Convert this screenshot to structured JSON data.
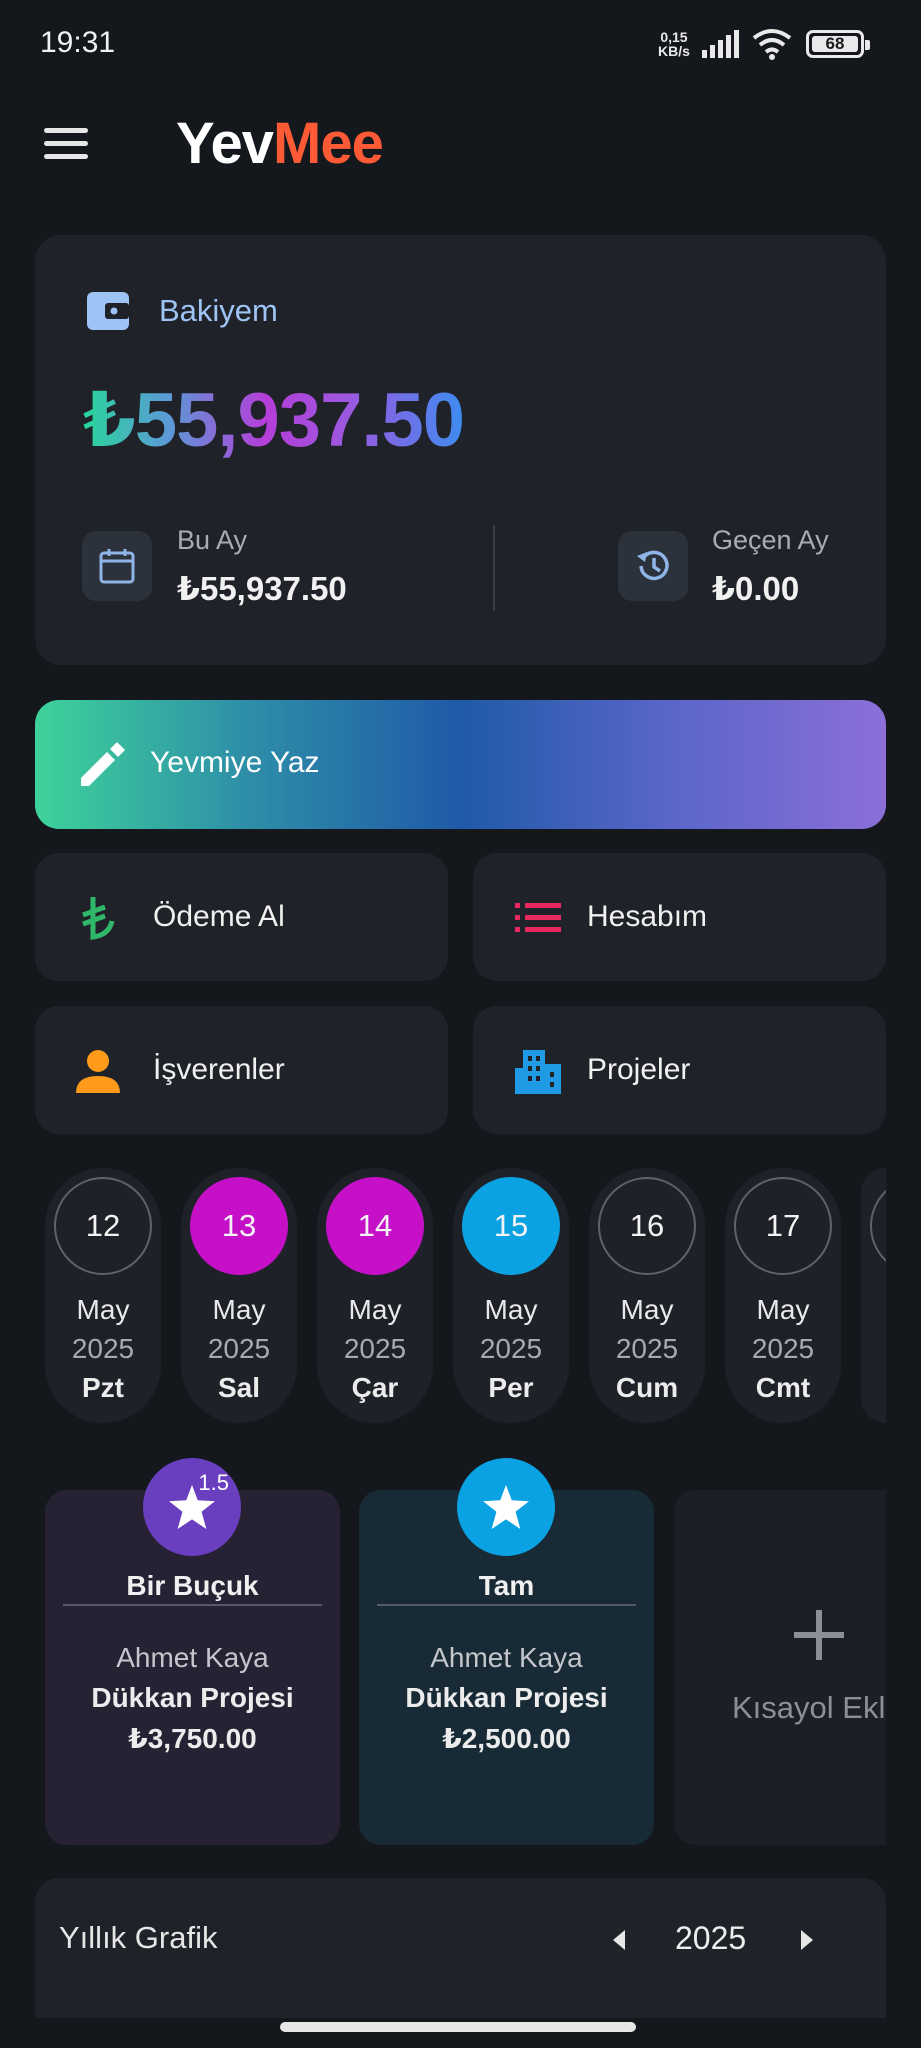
{
  "status": {
    "time": "19:31",
    "speed_value": "0,15",
    "speed_unit": "KB/s",
    "battery": "68"
  },
  "header": {
    "logo_part1": "Yev",
    "logo_part2": "Mee"
  },
  "balance": {
    "label": "Bakiyem",
    "amount": "₺55,937.50",
    "this_month_label": "Bu Ay",
    "this_month_value": "₺55,937.50",
    "last_month_label": "Geçen Ay",
    "last_month_value": "₺0.00"
  },
  "actions": {
    "yevmiye_label": "Yevmiye Yaz",
    "odeme_label": "Ödeme Al",
    "hesabim_label": "Hesabım",
    "isverenler_label": "İşverenler",
    "projeler_label": "Projeler"
  },
  "days": [
    {
      "day": "12",
      "month": "May",
      "year": "2025",
      "weekday": "Pzt",
      "state": "normal"
    },
    {
      "day": "13",
      "month": "May",
      "year": "2025",
      "weekday": "Sal",
      "state": "marked"
    },
    {
      "day": "14",
      "month": "May",
      "year": "2025",
      "weekday": "Çar",
      "state": "marked"
    },
    {
      "day": "15",
      "month": "May",
      "year": "2025",
      "weekday": "Per",
      "state": "today"
    },
    {
      "day": "16",
      "month": "May",
      "year": "2025",
      "weekday": "Cum",
      "state": "normal"
    },
    {
      "day": "17",
      "month": "May",
      "year": "2025",
      "weekday": "Cmt",
      "state": "normal"
    }
  ],
  "shortcuts": [
    {
      "badge_number": "1.5",
      "title": "Bir Buçuk",
      "person": "Ahmet Kaya",
      "project": "Dükkan Projesi",
      "amount": "₺3,750.00",
      "color": "#6a3fbf",
      "bg": "#262234"
    },
    {
      "badge_number": "",
      "title": "Tam",
      "person": "Ahmet Kaya",
      "project": "Dükkan Projesi",
      "amount": "₺2,500.00",
      "color": "#0aa2e3",
      "bg": "#172a35"
    }
  ],
  "add_shortcut_label": "Kısayol Ekle",
  "annual_chart": {
    "title": "Yıllık Grafik",
    "year": "2025"
  }
}
